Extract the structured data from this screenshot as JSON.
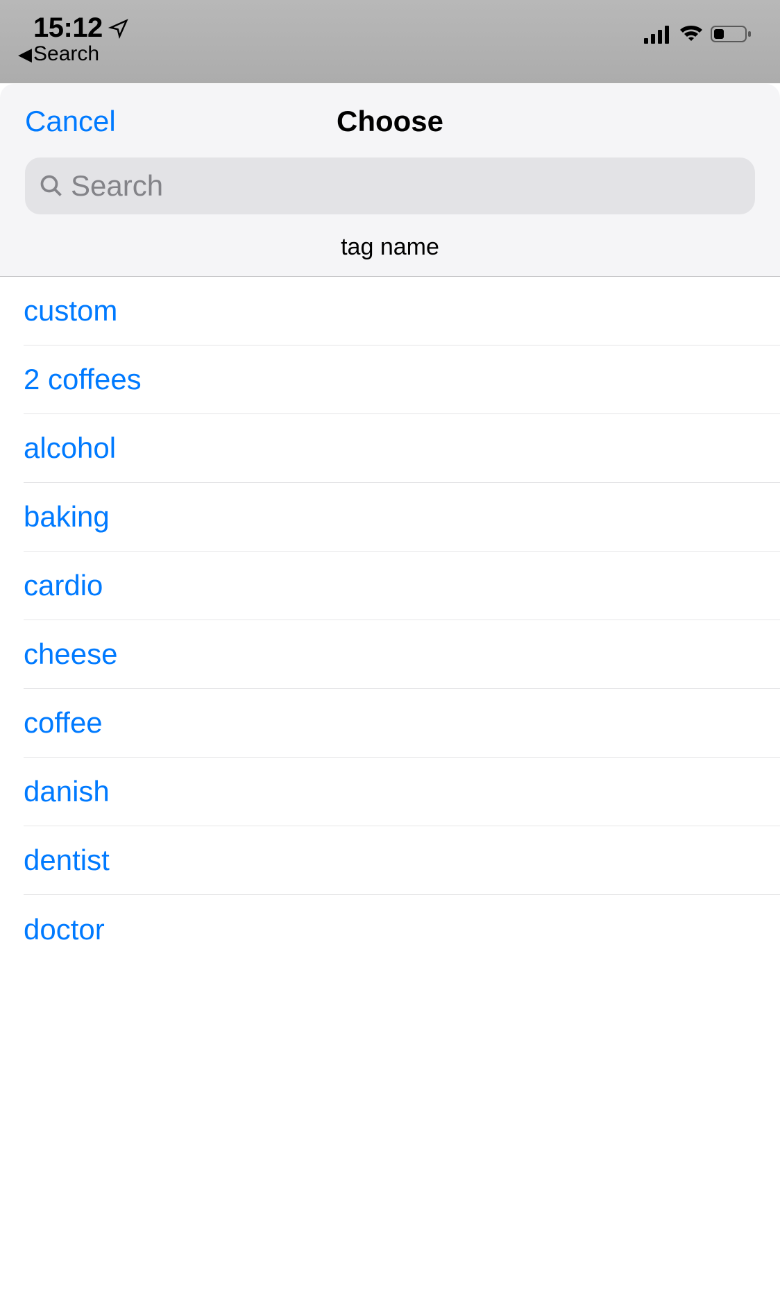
{
  "statusBar": {
    "time": "15:12",
    "backLabel": "Search"
  },
  "modal": {
    "cancelLabel": "Cancel",
    "title": "Choose",
    "searchPlaceholder": "Search",
    "sectionHeader": "tag name"
  },
  "tags": [
    "custom",
    "2 coffees",
    "alcohol",
    "baking",
    "cardio",
    "cheese",
    "coffee",
    "danish",
    "dentist",
    "doctor"
  ],
  "colors": {
    "accent": "#007aff"
  }
}
